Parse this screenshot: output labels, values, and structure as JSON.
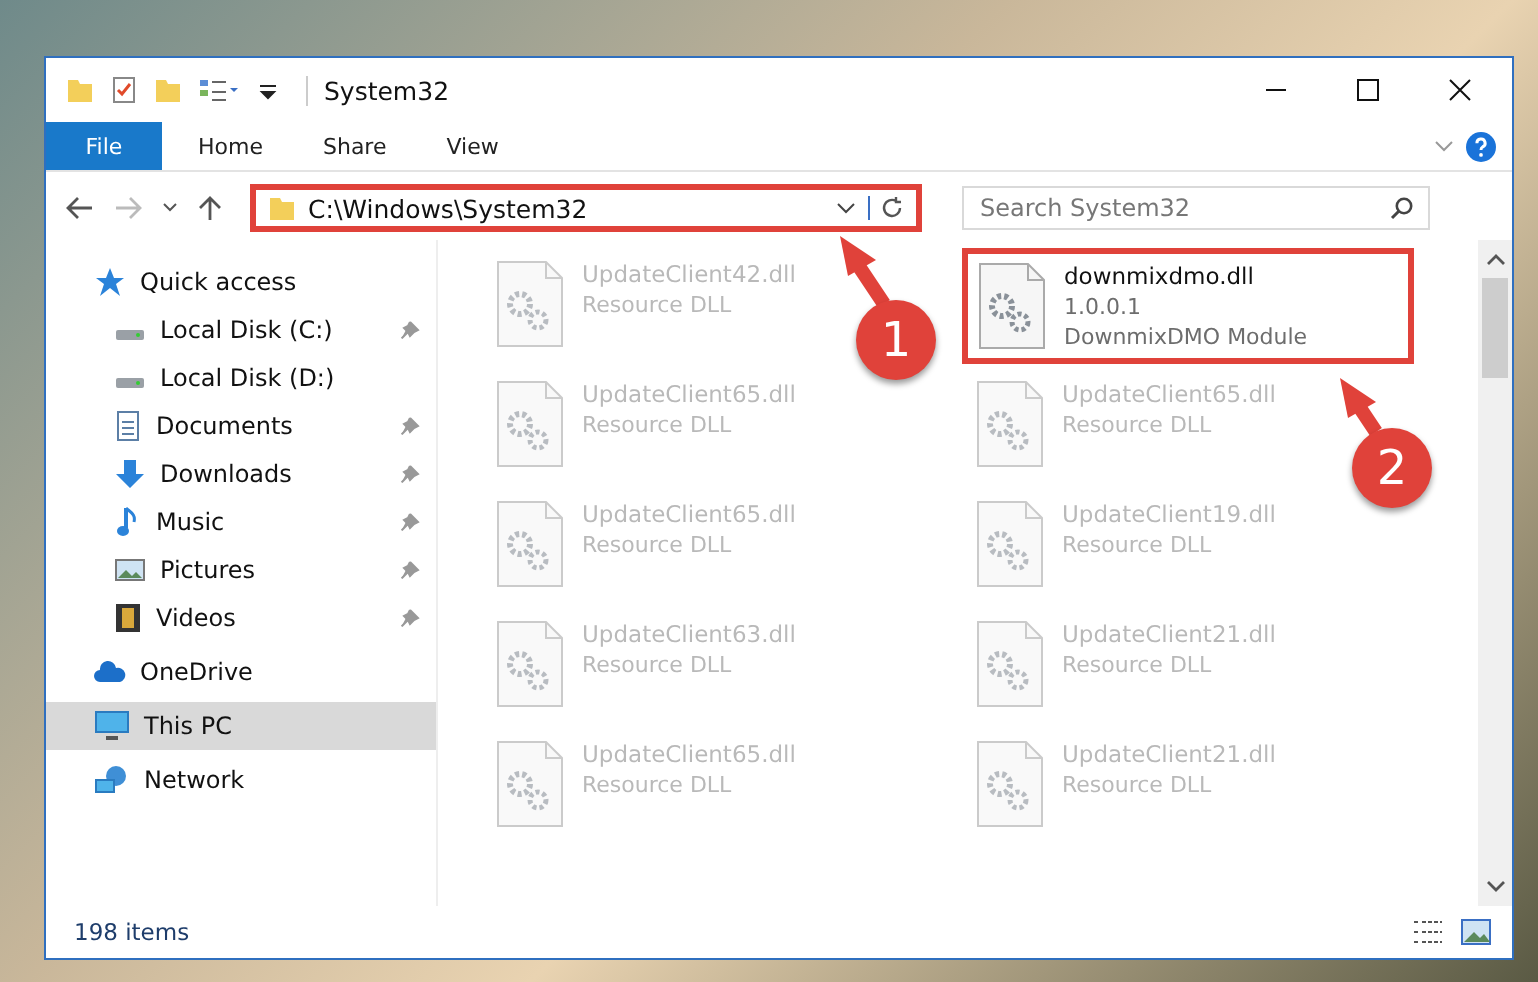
{
  "window": {
    "title": "System32"
  },
  "ribbon": {
    "file_tab": "File",
    "tabs": [
      "Home",
      "Share",
      "View"
    ]
  },
  "address": {
    "path": "C:\\Windows\\System32",
    "highlighted": true
  },
  "search": {
    "placeholder": "Search System32"
  },
  "sidebar": {
    "items": [
      {
        "label": "Quick access",
        "kind": "star",
        "selected": false,
        "children": [
          {
            "label": "Local Disk (C:)",
            "kind": "disk",
            "pinned": true,
            "selected": false
          },
          {
            "label": "Local Disk (D:)",
            "kind": "disk",
            "pinned": false,
            "selected": false
          },
          {
            "label": "Documents",
            "kind": "documents",
            "pinned": true,
            "selected": false
          },
          {
            "label": "Downloads",
            "kind": "downloads",
            "pinned": true,
            "selected": false
          },
          {
            "label": "Music",
            "kind": "music",
            "pinned": true,
            "selected": false
          },
          {
            "label": "Pictures",
            "kind": "pictures",
            "pinned": true,
            "selected": false
          },
          {
            "label": "Videos",
            "kind": "videos",
            "pinned": true,
            "selected": false
          }
        ]
      },
      {
        "label": "OneDrive",
        "kind": "cloud",
        "selected": false
      },
      {
        "label": "This PC",
        "kind": "pc",
        "selected": true
      },
      {
        "label": "Network",
        "kind": "network",
        "selected": false
      }
    ]
  },
  "files": [
    {
      "name": "UpdateClient42.dll",
      "lines": [
        "Resource DLL"
      ],
      "blurred": true,
      "highlighted": false
    },
    {
      "name": "downmixdmo.dll",
      "lines": [
        "1.0.0.1",
        "DownmixDMO Module"
      ],
      "blurred": false,
      "highlighted": true
    },
    {
      "name": "UpdateClient65.dll",
      "lines": [
        "Resource DLL"
      ],
      "blurred": true,
      "highlighted": false
    },
    {
      "name": "UpdateClient65.dll",
      "lines": [
        "Resource DLL"
      ],
      "blurred": true,
      "highlighted": false
    },
    {
      "name": "UpdateClient65.dll",
      "lines": [
        "Resource DLL"
      ],
      "blurred": true,
      "highlighted": false
    },
    {
      "name": "UpdateClient19.dll",
      "lines": [
        "Resource DLL"
      ],
      "blurred": true,
      "highlighted": false
    },
    {
      "name": "UpdateClient63.dll",
      "lines": [
        "Resource DLL"
      ],
      "blurred": true,
      "highlighted": false
    },
    {
      "name": "UpdateClient21.dll",
      "lines": [
        "Resource DLL"
      ],
      "blurred": true,
      "highlighted": false
    },
    {
      "name": "UpdateClient65.dll",
      "lines": [
        "Resource DLL"
      ],
      "blurred": true,
      "highlighted": false
    },
    {
      "name": "UpdateClient21.dll",
      "lines": [
        "Resource DLL"
      ],
      "blurred": true,
      "highlighted": false
    }
  ],
  "status_bar": {
    "count": "198 items"
  },
  "annotations": [
    {
      "label": "1"
    },
    {
      "label": "2"
    }
  ]
}
